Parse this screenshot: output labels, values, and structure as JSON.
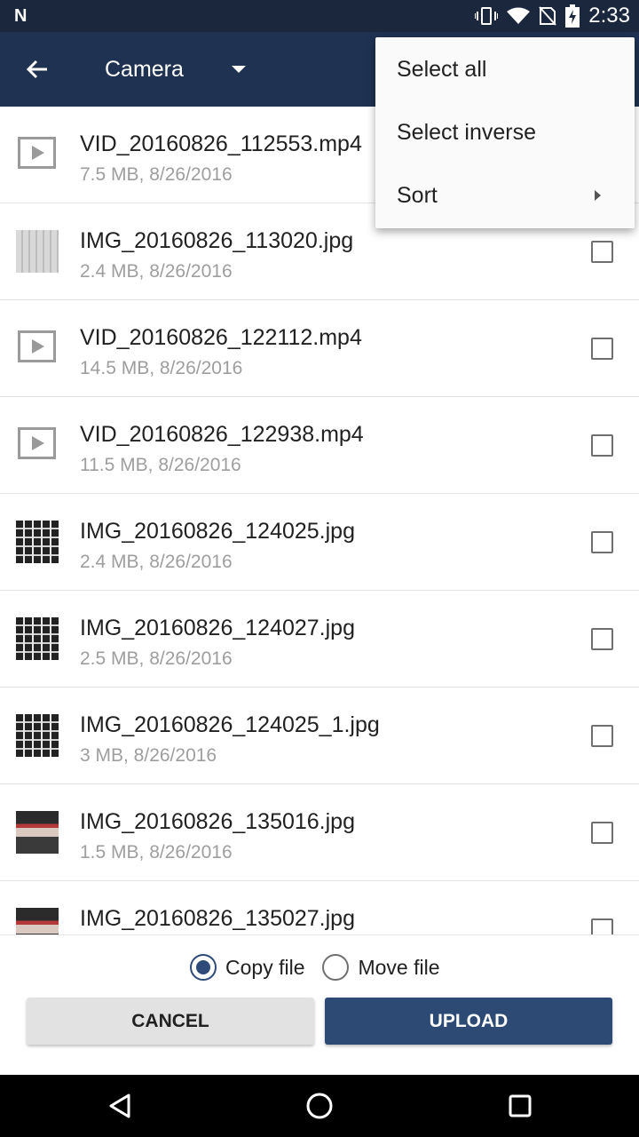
{
  "status_bar": {
    "time": "2:33",
    "icons": [
      "notification-n-icon",
      "vibrate-icon",
      "wifi-icon",
      "no-sim-icon",
      "battery-charging-icon"
    ]
  },
  "app_bar": {
    "back_icon": "arrow-back-icon",
    "folder_title": "Camera",
    "dropdown_icon": "caret-down-icon"
  },
  "menu": {
    "items": [
      {
        "label": "Select all"
      },
      {
        "label": "Select inverse"
      },
      {
        "label": "Sort",
        "submenu": true
      }
    ]
  },
  "files": [
    {
      "name": "VID_20160826_112553.mp4",
      "meta": "7.5 MB, 8/26/2016",
      "type": "video"
    },
    {
      "name": "IMG_20160826_113020.jpg",
      "meta": "2.4 MB, 8/26/2016",
      "type": "image"
    },
    {
      "name": "VID_20160826_122112.mp4",
      "meta": "14.5 MB, 8/26/2016",
      "type": "video"
    },
    {
      "name": "VID_20160826_122938.mp4",
      "meta": "11.5 MB, 8/26/2016",
      "type": "video"
    },
    {
      "name": "IMG_20160826_124025.jpg",
      "meta": "2.4 MB, 8/26/2016",
      "type": "image"
    },
    {
      "name": "IMG_20160826_124027.jpg",
      "meta": "2.5 MB, 8/26/2016",
      "type": "image"
    },
    {
      "name": "IMG_20160826_124025_1.jpg",
      "meta": "3 MB, 8/26/2016",
      "type": "image"
    },
    {
      "name": "IMG_20160826_135016.jpg",
      "meta": "1.5 MB, 8/26/2016",
      "type": "image"
    },
    {
      "name": "IMG_20160826_135027.jpg",
      "meta": "",
      "type": "image"
    }
  ],
  "options": {
    "copy_label": "Copy file",
    "move_label": "Move file",
    "selected": "copy"
  },
  "buttons": {
    "cancel": "CANCEL",
    "upload": "UPLOAD"
  },
  "nav_bar": {
    "icons": [
      "back-triangle-icon",
      "home-circle-icon",
      "recents-square-icon"
    ]
  },
  "colors": {
    "status_bar": "#1a273c",
    "app_bar": "#1f3252",
    "accent": "#2c4a73"
  }
}
